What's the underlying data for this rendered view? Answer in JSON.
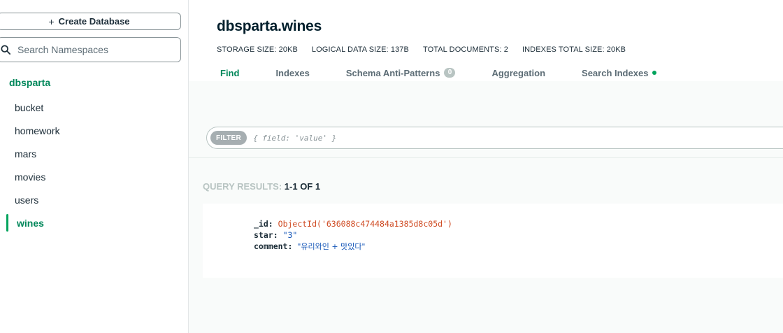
{
  "sidebar": {
    "create_db_label": "Create Database",
    "search_placeholder": "Search Namespaces",
    "database": "dbsparta",
    "collections": [
      "bucket",
      "homework",
      "mars",
      "movies",
      "users",
      "wines"
    ],
    "active_collection": "wines"
  },
  "header": {
    "title": "dbsparta.wines",
    "stats": {
      "storage_size": "STORAGE SIZE: 20KB",
      "logical_data_size": "LOGICAL DATA SIZE: 137B",
      "total_documents": "TOTAL DOCUMENTS: 2",
      "indexes_total_size": "INDEXES TOTAL SIZE: 20KB"
    },
    "tabs": [
      {
        "label": "Find",
        "active": true
      },
      {
        "label": "Indexes"
      },
      {
        "label": "Schema Anti-Patterns",
        "badge": "0"
      },
      {
        "label": "Aggregation"
      },
      {
        "label": "Search Indexes"
      }
    ]
  },
  "filter": {
    "label": "FILTER",
    "placeholder": "{ field: 'value' }"
  },
  "results": {
    "label": "QUERY RESULTS:",
    "count": "1-1 OF 1"
  },
  "document": {
    "id_key": "_id:",
    "id_value": "ObjectId('636088c474484a1385d8c05d')",
    "star_key": "star:",
    "star_value": "\"3\"",
    "comment_key": "comment:",
    "comment_value": "\"유리와인 + 맛있다\""
  },
  "colors": {
    "accent_green": "#00875a",
    "dot_green": "#00a35c",
    "oid_red": "#cf4a22",
    "string_blue": "#1254b7"
  }
}
